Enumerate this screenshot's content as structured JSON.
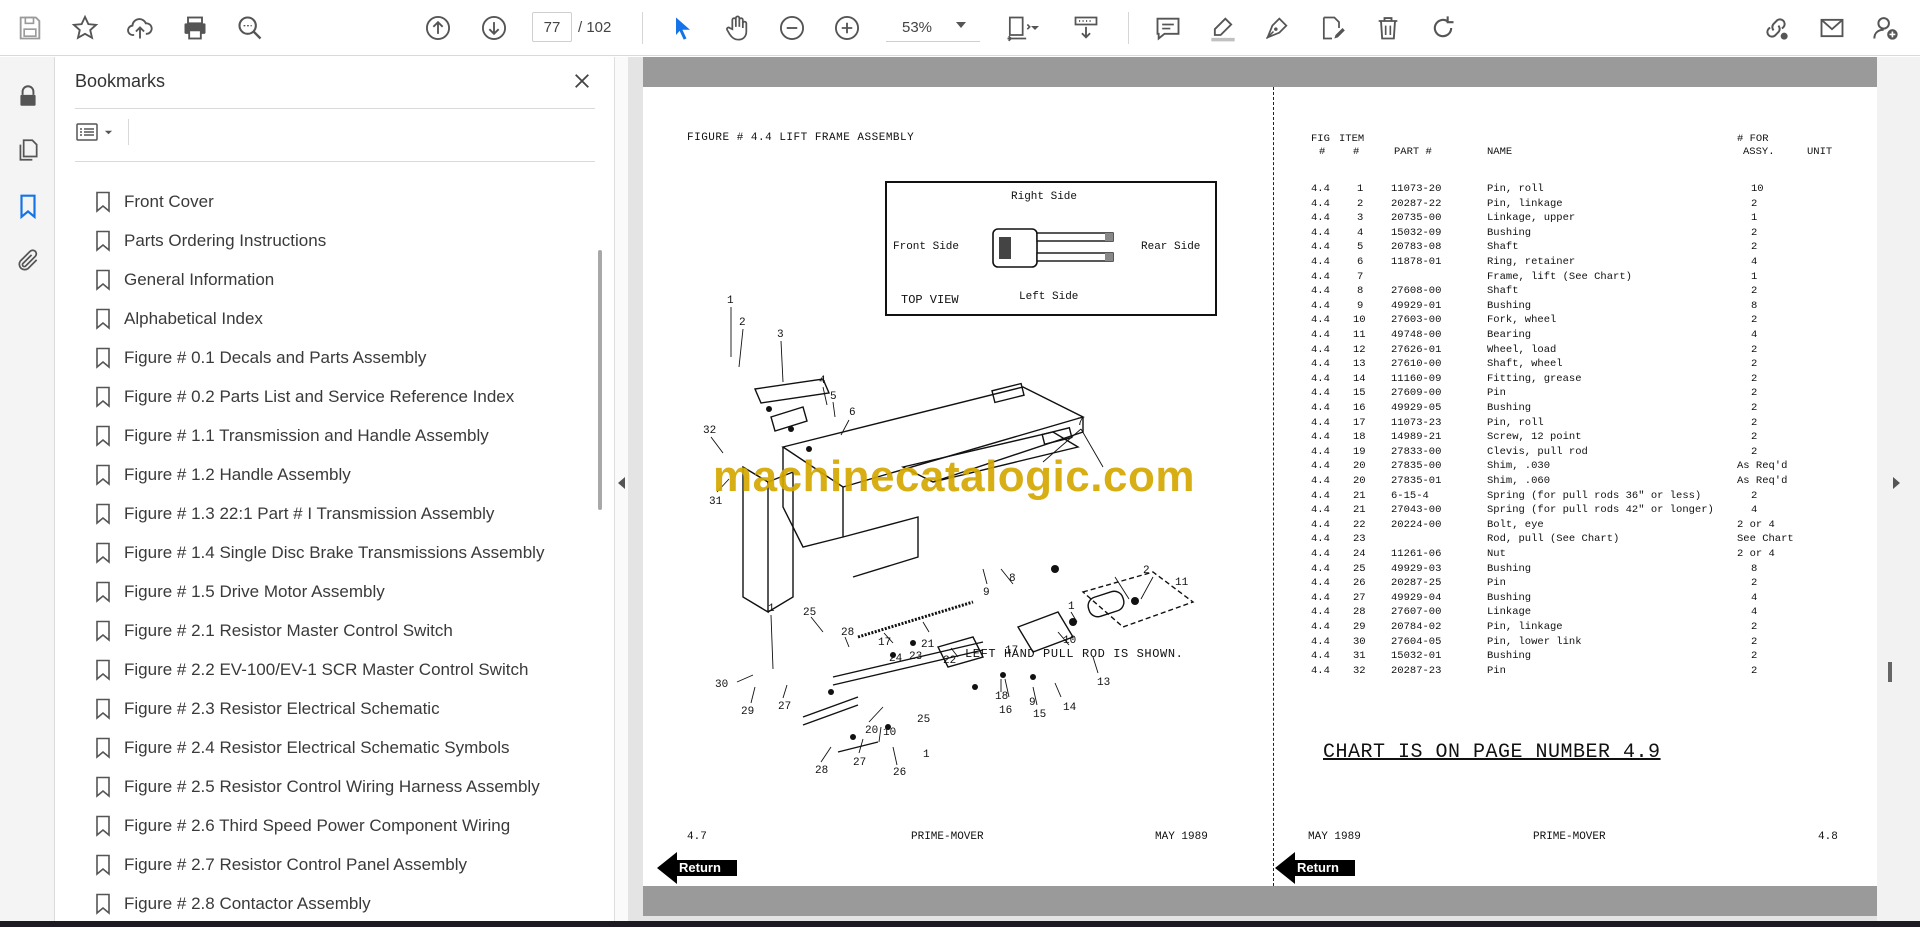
{
  "toolbar": {
    "current_page": "77",
    "total_pages": "/ 102",
    "zoom": "53%",
    "accent_color": "#1473e6"
  },
  "bookmarks": {
    "title": "Bookmarks",
    "items": [
      "Front Cover",
      "Parts Ordering Instructions",
      "General Information",
      "Alphabetical Index",
      "Figure # 0.1 Decals and Parts Assembly",
      "Figure # 0.2 Parts List and Service Reference Index",
      "Figure # 1.1 Transmission and Handle Assembly",
      "Figure # 1.2 Handle Assembly",
      "Figure # 1.3 22:1 Part # I Transmission Assembly",
      "Figure # 1.4 Single Disc Brake Transmissions Assembly",
      "Figure # 1.5 Drive Motor Assembly",
      "Figure # 2.1 Resistor Master Control Switch",
      "Figure # 2.2 EV-100/EV-1 SCR Master Control Switch",
      "Figure # 2.3 Resistor Electrical Schematic",
      "Figure # 2.4 Resistor Electrical Schematic Symbols",
      "Figure # 2.5 Resistor Control Wiring Harness Assembly",
      "Figure # 2.6 Third Speed Power Component Wiring",
      "Figure # 2.7 Resistor Control Panel Assembly",
      "Figure # 2.8 Contactor Assembly"
    ]
  },
  "left_page": {
    "figure_title": "FIGURE # 4.4 LIFT FRAME ASSEMBLY",
    "top_view": {
      "right_side": "Right Side",
      "front_side": "Front Side",
      "rear_side": "Rear Side",
      "left_side": "Left Side",
      "label": "TOP VIEW"
    },
    "callouts": [
      "1",
      "2",
      "3",
      "4",
      "5",
      "6",
      "32",
      "31",
      "7",
      "8",
      "9",
      "1",
      "2",
      "11",
      "10",
      "13",
      "14",
      "15",
      "16",
      "9",
      "18",
      "17",
      "22",
      "21",
      "24",
      "23",
      "25",
      "28",
      "17",
      "30",
      "29",
      "27",
      "1",
      "20",
      "10",
      "25",
      "28",
      "27",
      "26",
      "1"
    ],
    "note": "LEFT HAND PULL ROD IS SHOWN.",
    "footer_left": "4.7",
    "footer_center": "PRIME-MOVER",
    "footer_right": "MAY 1989",
    "return_label": "Return"
  },
  "watermark": "machinecatalogic.com",
  "right_page": {
    "headers": {
      "fig_top": "FIG",
      "item_top": "ITEM",
      "fig": "#",
      "item": "#",
      "part": "PART #",
      "name": "NAME",
      "for_top": "# FOR",
      "assy": "ASSY.",
      "unit": "UNIT"
    },
    "rows": [
      [
        "4.4",
        "1",
        "11073-20",
        "Pin, roll",
        "10"
      ],
      [
        "4.4",
        "2",
        "20287-22",
        "Pin, linkage",
        "2"
      ],
      [
        "4.4",
        "3",
        "20735-00",
        "Linkage, upper",
        "1"
      ],
      [
        "4.4",
        "4",
        "15032-09",
        "Bushing",
        "2"
      ],
      [
        "4.4",
        "5",
        "20783-08",
        "Shaft",
        "2"
      ],
      [
        "4.4",
        "6",
        "11878-01",
        "Ring, retainer",
        "4"
      ],
      [
        "4.4",
        "7",
        "",
        "Frame, lift (See Chart)",
        "1"
      ],
      [
        "4.4",
        "8",
        "27608-00",
        "Shaft",
        "2"
      ],
      [
        "4.4",
        "9",
        "49929-01",
        "Bushing",
        "8"
      ],
      [
        "4.4",
        "10",
        "27603-00",
        "Fork, wheel",
        "2"
      ],
      [
        "4.4",
        "11",
        "49748-00",
        "Bearing",
        "4"
      ],
      [
        "4.4",
        "12",
        "27626-01",
        "Wheel, load",
        "2"
      ],
      [
        "4.4",
        "13",
        "27610-00",
        "Shaft, wheel",
        "2"
      ],
      [
        "4.4",
        "14",
        "11160-09",
        "Fitting, grease",
        "2"
      ],
      [
        "4.4",
        "15",
        "27609-00",
        "Pin",
        "2"
      ],
      [
        "4.4",
        "16",
        "49929-05",
        "Bushing",
        "2"
      ],
      [
        "4.4",
        "17",
        "11073-23",
        "Pin, roll",
        "2"
      ],
      [
        "4.4",
        "18",
        "14989-21",
        "Screw, 12 point",
        "2"
      ],
      [
        "4.4",
        "19",
        "27833-00",
        "Clevis, pull rod",
        "2"
      ],
      [
        "4.4",
        "20",
        "27835-00",
        "Shim, .030",
        "As Req'd"
      ],
      [
        "4.4",
        "20",
        "27835-01",
        "Shim, .060",
        "As Req'd"
      ],
      [
        "4.4",
        "21",
        "6-15-4",
        "Spring (for pull rods 36\" or less)",
        "2"
      ],
      [
        "4.4",
        "21",
        "27043-00",
        "Spring (for pull rods 42\" or longer)",
        "4"
      ],
      [
        "4.4",
        "22",
        "20224-00",
        "Bolt, eye",
        "2 or 4"
      ],
      [
        "4.4",
        "23",
        "",
        "Rod, pull (See Chart)",
        "See Chart"
      ],
      [
        "4.4",
        "24",
        "11261-06",
        "Nut",
        "2 or 4"
      ],
      [
        "4.4",
        "25",
        "49929-03",
        "Bushing",
        "8"
      ],
      [
        "4.4",
        "26",
        "20287-25",
        "Pin",
        "2"
      ],
      [
        "4.4",
        "27",
        "49929-04",
        "Bushing",
        "4"
      ],
      [
        "4.4",
        "28",
        "27607-00",
        "Linkage",
        "4"
      ],
      [
        "4.4",
        "29",
        "20784-02",
        "Pin, linkage",
        "2"
      ],
      [
        "4.4",
        "30",
        "27604-05",
        "Pin, lower link",
        "2"
      ],
      [
        "4.4",
        "31",
        "15032-01",
        "Bushing",
        "2"
      ],
      [
        "4.4",
        "32",
        "20287-23",
        "Pin",
        "2"
      ]
    ],
    "chart_note": "CHART IS ON PAGE NUMBER 4.9",
    "footer_left": "MAY 1989",
    "footer_center": "PRIME-MOVER",
    "footer_right": "4.8",
    "return_label": "Return"
  }
}
